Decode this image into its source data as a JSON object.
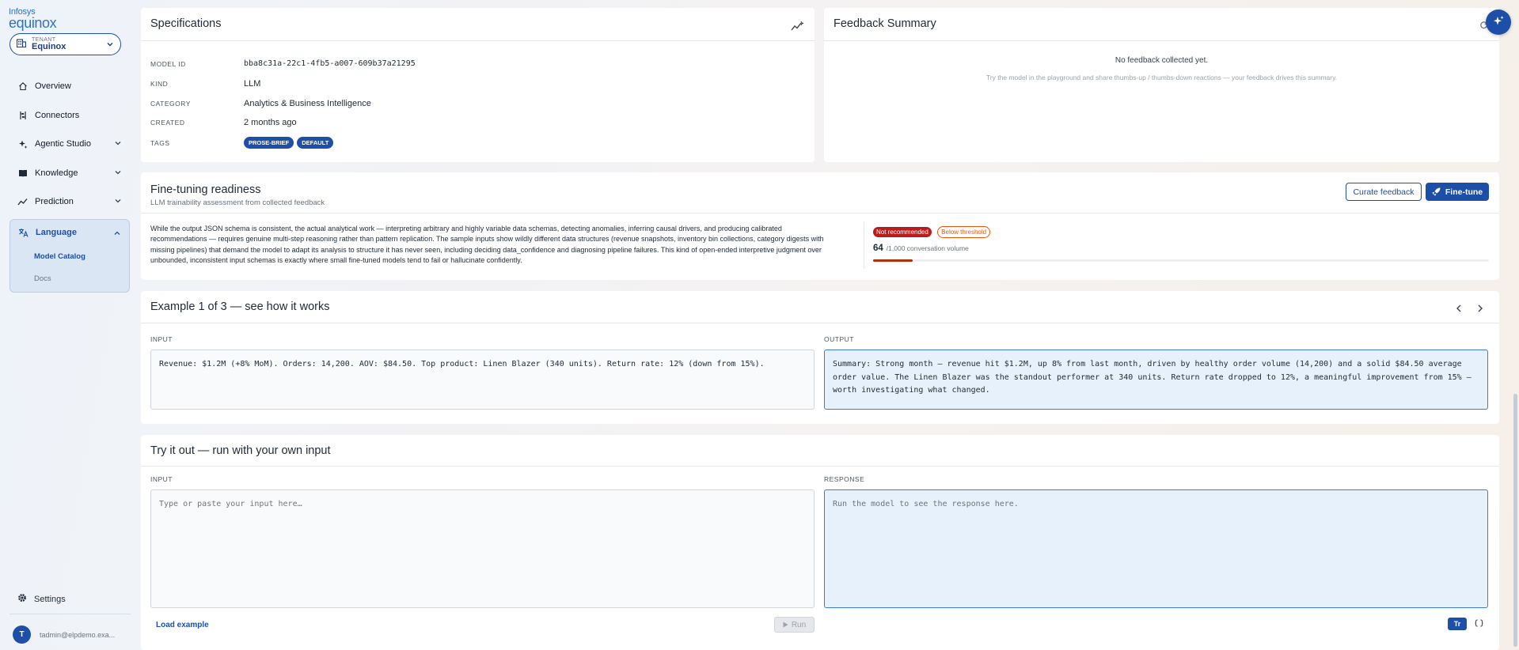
{
  "brand": {
    "line1": "Infosys",
    "line2": "equinox"
  },
  "tenant": {
    "label": "TENANT",
    "name": "Equinox"
  },
  "nav": {
    "overview": "Overview",
    "connectors": "Connectors",
    "agentic_studio": "Agentic Studio",
    "knowledge": "Knowledge",
    "prediction": "Prediction",
    "language": "Language",
    "model_catalog": "Model Catalog",
    "docs": "Docs",
    "settings": "Settings"
  },
  "user": {
    "initial": "T",
    "email": "tadmin@elpdemo.exa..."
  },
  "specifications": {
    "title": "Specifications",
    "rows": [
      {
        "key": "MODEL ID",
        "value": "bba8c31a-22c1-4fb5-a007-609b37a21295"
      },
      {
        "key": "KIND",
        "value": "LLM"
      },
      {
        "key": "CATEGORY",
        "value": "Analytics & Business Intelligence"
      },
      {
        "key": "CREATED",
        "value": "2 months ago"
      }
    ],
    "tags_key": "TAGS",
    "tags": [
      "PROSE-BRIEF",
      "DEFAULT"
    ]
  },
  "feedback": {
    "title": "Feedback Summary",
    "empty": "No feedback collected yet.",
    "hint": "Try the model in the playground and share thumbs-up / thumbs-down reactions — your feedback drives this summary."
  },
  "finetune": {
    "title": "Fine-tuning readiness",
    "subtitle": "LLM trainability assessment from collected feedback",
    "curate_btn": "Curate feedback",
    "finetune_btn": "Fine-tune",
    "description": "While the output JSON schema is consistent, the actual analytical work — interpreting arbitrary and highly variable data schemas, detecting anomalies, inferring causal drivers, and producing calibrated recommendations — requires genuine multi-step reasoning rather than pattern replication. The sample inputs show wildly different data structures (revenue snapshots, inventory bin collections, category digests with missing pipelines) that demand the model to adapt its analysis to structure it has never seen, including deciding data_confidence and diagnosing pipeline failures. This kind of open-ended interpretive judgment over unbounded, inconsistent input schemas is exactly where small fine-tuned models tend to fail or hallucinate confidently.",
    "badge_not_recommended": "Not recommended",
    "badge_below": "Below threshold",
    "count": "64",
    "count_suffix": "/1,000 conversation volume",
    "progress": 0.064,
    "colors": {
      "progress": "#b3300f",
      "primary": "#1e4fa8"
    }
  },
  "example": {
    "title": "Example 1 of 3 — see how it works",
    "input_label": "INPUT",
    "output_label": "OUTPUT",
    "input_text": "Revenue: $1.2M (+8% MoM). Orders: 14,200. AOV: $84.50. Top product: Linen Blazer (340 units). Return rate: 12% (down from 15%).",
    "output_text": "Summary: Strong month — revenue hit $1.2M, up 8% from last month, driven by healthy order volume (14,200) and a solid $84.50 average order value. The Linen Blazer was the standout performer at 340 units. Return rate dropped to 12%, a meaningful improvement from 15% — worth investigating what changed."
  },
  "tryit": {
    "title": "Try it out — run with your own input",
    "input_label": "INPUT",
    "response_label": "RESPONSE",
    "input_placeholder": "Type or paste your input here…",
    "response_placeholder": "Run the model to see the response here.",
    "load_example": "Load example",
    "run": "Run",
    "toggle_text": "Tr"
  },
  "icons": {
    "home": "home-icon",
    "connectors": "connectors-icon",
    "agentic": "sparkle-icon",
    "knowledge": "book-icon",
    "prediction": "trend-icon",
    "language": "translate-icon",
    "settings": "gear-icon"
  }
}
